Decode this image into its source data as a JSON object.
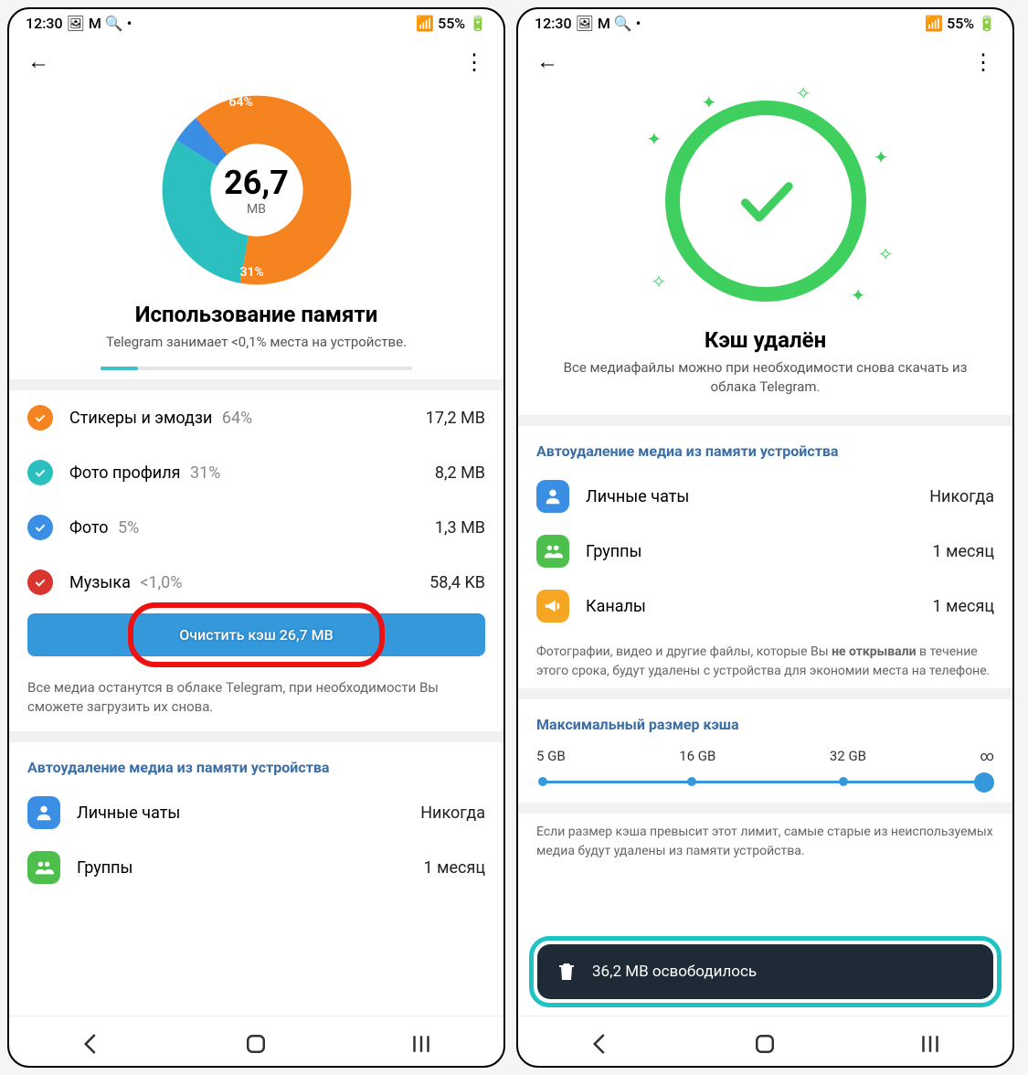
{
  "statusbar": {
    "time": "12:30",
    "battery": "55%"
  },
  "chart_data": {
    "type": "pie",
    "title": "Использование памяти",
    "center_value": "26,7",
    "center_unit": "MB",
    "slices": [
      {
        "label": "Стикеры и эмодзи",
        "pct": 64,
        "color": "#f5831f",
        "size": "17,2 MB"
      },
      {
        "label": "Фото профиля",
        "pct": 31,
        "color": "#2cbfbf",
        "size": "8,2 MB"
      },
      {
        "label": "Фото",
        "pct": 5,
        "color": "#3a8fe5",
        "size": "1,3 MB"
      },
      {
        "label": "Музыка",
        "pct": 0.5,
        "color": "#d9342d",
        "size": "58,4 KB"
      }
    ]
  },
  "left": {
    "title": "Использование памяти",
    "subtitle": "Telegram занимает <0,1% места на устройстве.",
    "rows": [
      {
        "label": "Стикеры и эмодзи",
        "pct": "64%",
        "size": "17,2 MB",
        "color": "#f5831f"
      },
      {
        "label": "Фото профиля",
        "pct": "31%",
        "size": "8,2 MB",
        "color": "#2cbfbf"
      },
      {
        "label": "Фото",
        "pct": "5%",
        "size": "1,3 MB",
        "color": "#3a8fe5"
      },
      {
        "label": "Музыка",
        "pct": "<1,0%",
        "size": "58,4 KB",
        "color": "#d9342d"
      }
    ],
    "clear_button": "Очистить кэш  26,7 MB",
    "note": "Все медиа останутся в облаке Telegram, при необходимости Вы сможете загрузить их снова.",
    "autodelete_title": "Автоудаление медиа из памяти устройства",
    "autodelete": [
      {
        "label": "Личные чаты",
        "value": "Никогда",
        "color": "#3a8fe5"
      },
      {
        "label": "Группы",
        "value": "1 месяц",
        "color": "#4cbf4c"
      }
    ]
  },
  "right": {
    "title": "Кэш удалён",
    "subtitle": "Все медиафайлы можно при необходимости снова скачать из облака Telegram.",
    "autodelete_title": "Автоудаление медиа из памяти устройства",
    "autodelete": [
      {
        "label": "Личные чаты",
        "value": "Никогда",
        "color": "#3a8fe5"
      },
      {
        "label": "Группы",
        "value": "1 месяц",
        "color": "#4cbf4c"
      },
      {
        "label": "Каналы",
        "value": "1 месяц",
        "color": "#f5a623"
      }
    ],
    "autodelete_note_prefix": "Фотографии, видео и другие файлы, которые Вы ",
    "autodelete_note_bold": "не открывали",
    "autodelete_note_suffix": " в течение этого срока, будут удалены с устройства для экономии места на телефоне.",
    "cache_size_title": "Максимальный размер кэша",
    "slider_labels": [
      "5 GB",
      "16 GB",
      "32 GB",
      "∞"
    ],
    "cache_size_note": "Если размер кэша превысит этот лимит, самые старые из неиспользуемых медиа будут удалены из памяти устройства.",
    "toast": "36,2 MB освободилось"
  }
}
